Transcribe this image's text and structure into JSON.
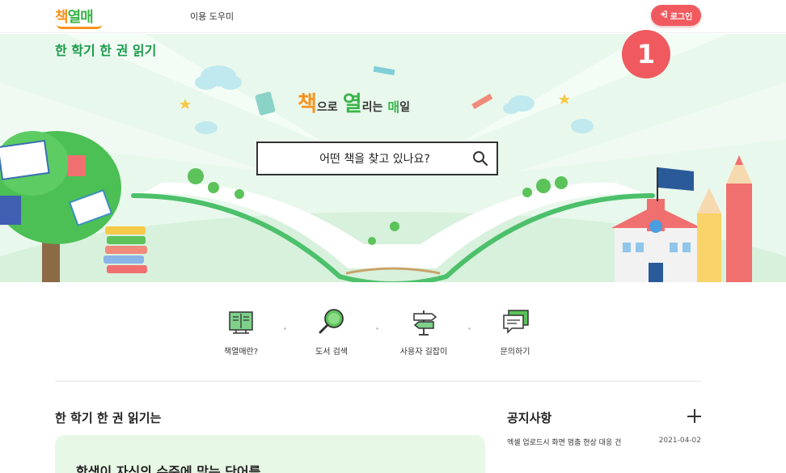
{
  "header": {
    "logo": "책열매",
    "nav_help": "이용 도우미",
    "login_label": "로그인"
  },
  "hero": {
    "title": "한 학기 한 권 읽기",
    "slogan": {
      "w1": "책",
      "w2": "으로",
      "w3": "열",
      "w4": "리는",
      "w5": "매",
      "w6": "일"
    },
    "search_placeholder": "어떤 책을 찾고 있나요?"
  },
  "badge": "1",
  "quick_menu": [
    {
      "label": "책열매란?",
      "icon": "book-stand-icon"
    },
    {
      "label": "도서 검색",
      "icon": "magnifier-icon"
    },
    {
      "label": "사용자 길잡이",
      "icon": "signpost-icon"
    },
    {
      "label": "문의하기",
      "icon": "chat-bubble-icon"
    }
  ],
  "intro": {
    "title": "한 학기 한 권 읽기는",
    "text": "학생이 자신의 수준에 맞는 단어를"
  },
  "notice": {
    "title": "공지사항",
    "items": [
      {
        "text": "엑셀 업로드시 화면 멈춤 현상 대응 건",
        "date": "2021-04-02"
      }
    ]
  },
  "colors": {
    "accent_red": "#f05a5f",
    "brand_green": "#39b54a",
    "brand_orange": "#f7931e",
    "hero_bg": "#e9f8ec"
  }
}
